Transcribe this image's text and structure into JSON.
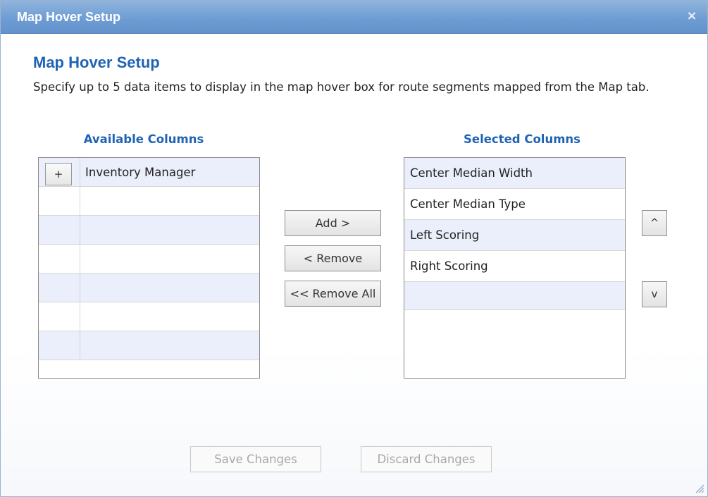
{
  "window": {
    "title": "Map Hover Setup",
    "close_symbol": "×"
  },
  "main": {
    "heading": "Map Hover Setup",
    "description": "Specify up to 5 data items to display in the map hover box for route segments mapped from the Map tab."
  },
  "available": {
    "header": "Available Columns",
    "add_symbol": "+",
    "items": [
      "Inventory Manager",
      "",
      "",
      "",
      "",
      "",
      ""
    ]
  },
  "selected": {
    "header": "Selected Columns",
    "items": [
      "Center Median Width",
      "Center Median Type",
      "Left Scoring",
      "Right Scoring",
      ""
    ]
  },
  "buttons": {
    "add": "Add >",
    "remove": "< Remove",
    "remove_all": "<< Remove All",
    "move_up": "^",
    "move_down": "v",
    "save": "Save Changes",
    "discard": "Discard Changes"
  },
  "colors": {
    "accent": "#1f63b5",
    "titlebar": "#6d9bd2",
    "row_alt": "#ebeffb",
    "disabled_text": "#a8a8a8"
  }
}
